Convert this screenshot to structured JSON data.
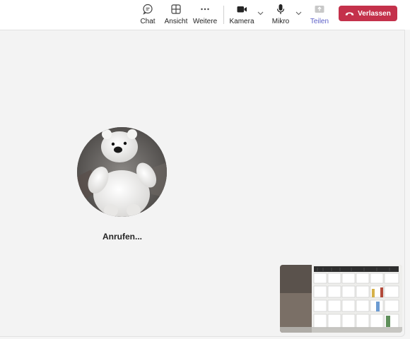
{
  "toolbar": {
    "chat_label": "Chat",
    "view_label": "Ansicht",
    "more_label": "Weitere",
    "camera_label": "Kamera",
    "mic_label": "Mikro",
    "share_label": "Teilen",
    "leave_label": "Verlassen"
  },
  "call": {
    "status_text": "Anrufen..."
  },
  "colors": {
    "leave": "#c4314b",
    "share_accent": "#5b5fc7",
    "stage_bg": "#f3f3f3"
  },
  "icons": [
    "chat-icon",
    "view-grid-icon",
    "more-icon",
    "camera-icon",
    "mic-icon",
    "share-icon",
    "phone-hangup-icon",
    "chevron-down-icon"
  ]
}
